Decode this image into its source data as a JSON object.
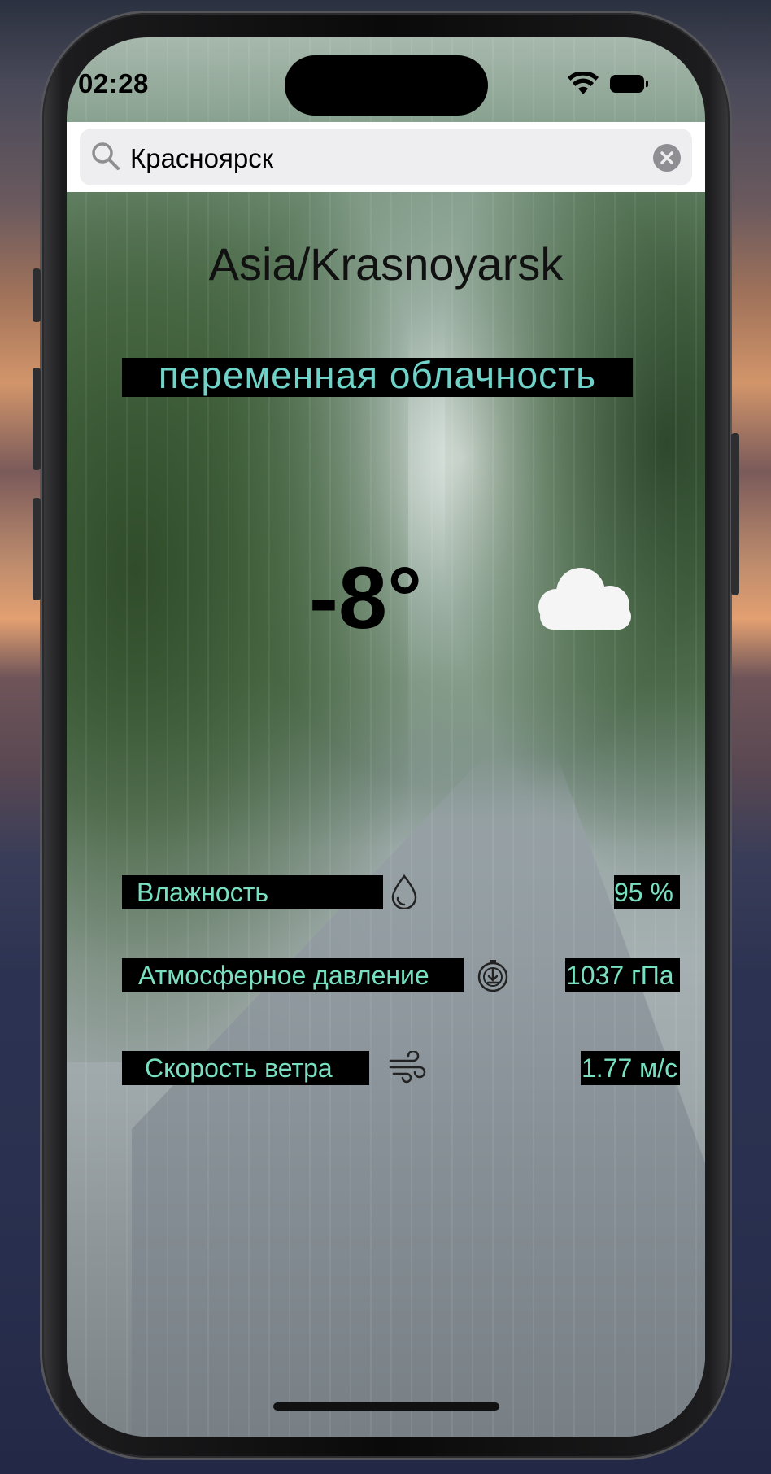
{
  "status_bar": {
    "time": "02:28",
    "icons": [
      "wifi-icon",
      "battery-icon"
    ]
  },
  "search": {
    "value": "Красноярск",
    "placeholder": ""
  },
  "weather": {
    "timezone": "Asia/Krasnoyarsk",
    "description": "переменная облачность",
    "temperature": "-8°",
    "condition_icon": "cloud-icon"
  },
  "details": [
    {
      "label": "Влажность",
      "icon": "humidity-drop-icon",
      "value": "95 %"
    },
    {
      "label": "Атмосферное давление",
      "icon": "pressure-gauge-icon",
      "value": "1037 гПа"
    },
    {
      "label": "Скорость ветра",
      "icon": "wind-icon",
      "value": "1.77 м/с"
    }
  ],
  "colors": {
    "description_text": "#6fd3c9",
    "detail_text": "#78e0c0",
    "label_background": "#000000"
  }
}
